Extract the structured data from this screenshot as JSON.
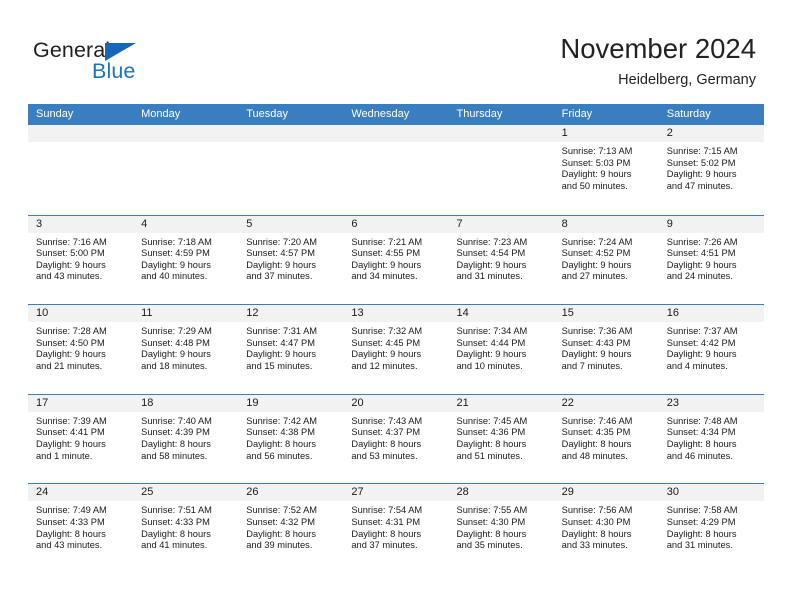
{
  "logo": {
    "word_one": "General",
    "word_two": "Blue",
    "triangle_icon": "blue-triangle-icon",
    "brand_blue": "#1b75bc",
    "brand_dark": "#231f20"
  },
  "header": {
    "title": "November 2024",
    "subtitle": "Heidelberg, Germany"
  },
  "theme": {
    "header_blue": "#3a7ebf",
    "date_strip_gray": "#f2f2f2",
    "text_dark": "#1a1a1a"
  },
  "calendar": {
    "weekdays": [
      "Sunday",
      "Monday",
      "Tuesday",
      "Wednesday",
      "Thursday",
      "Friday",
      "Saturday"
    ],
    "weeks": [
      [
        {
          "date": "",
          "lines": []
        },
        {
          "date": "",
          "lines": []
        },
        {
          "date": "",
          "lines": []
        },
        {
          "date": "",
          "lines": []
        },
        {
          "date": "",
          "lines": []
        },
        {
          "date": "1",
          "lines": [
            "Sunrise: 7:13 AM",
            "Sunset: 5:03 PM",
            "Daylight: 9 hours",
            "and 50 minutes."
          ]
        },
        {
          "date": "2",
          "lines": [
            "Sunrise: 7:15 AM",
            "Sunset: 5:02 PM",
            "Daylight: 9 hours",
            "and 47 minutes."
          ]
        }
      ],
      [
        {
          "date": "3",
          "lines": [
            "Sunrise: 7:16 AM",
            "Sunset: 5:00 PM",
            "Daylight: 9 hours",
            "and 43 minutes."
          ]
        },
        {
          "date": "4",
          "lines": [
            "Sunrise: 7:18 AM",
            "Sunset: 4:59 PM",
            "Daylight: 9 hours",
            "and 40 minutes."
          ]
        },
        {
          "date": "5",
          "lines": [
            "Sunrise: 7:20 AM",
            "Sunset: 4:57 PM",
            "Daylight: 9 hours",
            "and 37 minutes."
          ]
        },
        {
          "date": "6",
          "lines": [
            "Sunrise: 7:21 AM",
            "Sunset: 4:55 PM",
            "Daylight: 9 hours",
            "and 34 minutes."
          ]
        },
        {
          "date": "7",
          "lines": [
            "Sunrise: 7:23 AM",
            "Sunset: 4:54 PM",
            "Daylight: 9 hours",
            "and 31 minutes."
          ]
        },
        {
          "date": "8",
          "lines": [
            "Sunrise: 7:24 AM",
            "Sunset: 4:52 PM",
            "Daylight: 9 hours",
            "and 27 minutes."
          ]
        },
        {
          "date": "9",
          "lines": [
            "Sunrise: 7:26 AM",
            "Sunset: 4:51 PM",
            "Daylight: 9 hours",
            "and 24 minutes."
          ]
        }
      ],
      [
        {
          "date": "10",
          "lines": [
            "Sunrise: 7:28 AM",
            "Sunset: 4:50 PM",
            "Daylight: 9 hours",
            "and 21 minutes."
          ]
        },
        {
          "date": "11",
          "lines": [
            "Sunrise: 7:29 AM",
            "Sunset: 4:48 PM",
            "Daylight: 9 hours",
            "and 18 minutes."
          ]
        },
        {
          "date": "12",
          "lines": [
            "Sunrise: 7:31 AM",
            "Sunset: 4:47 PM",
            "Daylight: 9 hours",
            "and 15 minutes."
          ]
        },
        {
          "date": "13",
          "lines": [
            "Sunrise: 7:32 AM",
            "Sunset: 4:45 PM",
            "Daylight: 9 hours",
            "and 12 minutes."
          ]
        },
        {
          "date": "14",
          "lines": [
            "Sunrise: 7:34 AM",
            "Sunset: 4:44 PM",
            "Daylight: 9 hours",
            "and 10 minutes."
          ]
        },
        {
          "date": "15",
          "lines": [
            "Sunrise: 7:36 AM",
            "Sunset: 4:43 PM",
            "Daylight: 9 hours",
            "and 7 minutes."
          ]
        },
        {
          "date": "16",
          "lines": [
            "Sunrise: 7:37 AM",
            "Sunset: 4:42 PM",
            "Daylight: 9 hours",
            "and 4 minutes."
          ]
        }
      ],
      [
        {
          "date": "17",
          "lines": [
            "Sunrise: 7:39 AM",
            "Sunset: 4:41 PM",
            "Daylight: 9 hours",
            "and 1 minute."
          ]
        },
        {
          "date": "18",
          "lines": [
            "Sunrise: 7:40 AM",
            "Sunset: 4:39 PM",
            "Daylight: 8 hours",
            "and 58 minutes."
          ]
        },
        {
          "date": "19",
          "lines": [
            "Sunrise: 7:42 AM",
            "Sunset: 4:38 PM",
            "Daylight: 8 hours",
            "and 56 minutes."
          ]
        },
        {
          "date": "20",
          "lines": [
            "Sunrise: 7:43 AM",
            "Sunset: 4:37 PM",
            "Daylight: 8 hours",
            "and 53 minutes."
          ]
        },
        {
          "date": "21",
          "lines": [
            "Sunrise: 7:45 AM",
            "Sunset: 4:36 PM",
            "Daylight: 8 hours",
            "and 51 minutes."
          ]
        },
        {
          "date": "22",
          "lines": [
            "Sunrise: 7:46 AM",
            "Sunset: 4:35 PM",
            "Daylight: 8 hours",
            "and 48 minutes."
          ]
        },
        {
          "date": "23",
          "lines": [
            "Sunrise: 7:48 AM",
            "Sunset: 4:34 PM",
            "Daylight: 8 hours",
            "and 46 minutes."
          ]
        }
      ],
      [
        {
          "date": "24",
          "lines": [
            "Sunrise: 7:49 AM",
            "Sunset: 4:33 PM",
            "Daylight: 8 hours",
            "and 43 minutes."
          ]
        },
        {
          "date": "25",
          "lines": [
            "Sunrise: 7:51 AM",
            "Sunset: 4:33 PM",
            "Daylight: 8 hours",
            "and 41 minutes."
          ]
        },
        {
          "date": "26",
          "lines": [
            "Sunrise: 7:52 AM",
            "Sunset: 4:32 PM",
            "Daylight: 8 hours",
            "and 39 minutes."
          ]
        },
        {
          "date": "27",
          "lines": [
            "Sunrise: 7:54 AM",
            "Sunset: 4:31 PM",
            "Daylight: 8 hours",
            "and 37 minutes."
          ]
        },
        {
          "date": "28",
          "lines": [
            "Sunrise: 7:55 AM",
            "Sunset: 4:30 PM",
            "Daylight: 8 hours",
            "and 35 minutes."
          ]
        },
        {
          "date": "29",
          "lines": [
            "Sunrise: 7:56 AM",
            "Sunset: 4:30 PM",
            "Daylight: 8 hours",
            "and 33 minutes."
          ]
        },
        {
          "date": "30",
          "lines": [
            "Sunrise: 7:58 AM",
            "Sunset: 4:29 PM",
            "Daylight: 8 hours",
            "and 31 minutes."
          ]
        }
      ]
    ]
  }
}
